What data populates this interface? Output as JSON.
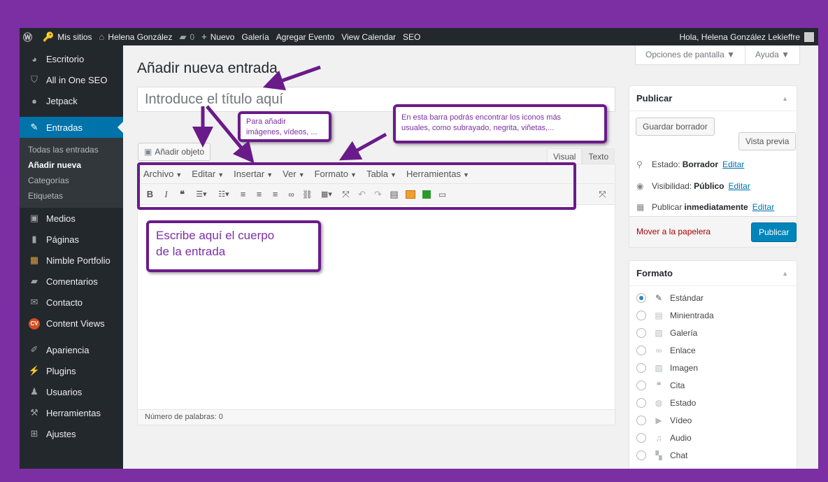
{
  "adminbar": {
    "my_sites": "Mis sitios",
    "site_name": "Helena González",
    "comments_count": "0",
    "new": "Nuevo",
    "gallery": "Galería",
    "add_event": "Agregar Evento",
    "view_calendar": "View Calendar",
    "seo": "SEO",
    "greeting": "Hola, Helena González Lekieffre"
  },
  "sidebar": {
    "items": [
      {
        "label": "Escritorio",
        "icon": "dashboard-icon"
      },
      {
        "label": "All in One SEO",
        "icon": "shield-icon"
      },
      {
        "label": "Jetpack",
        "icon": "jetpack-icon"
      },
      {
        "label": "Entradas",
        "icon": "pin-icon"
      },
      {
        "label": "Medios",
        "icon": "media-icon"
      },
      {
        "label": "Páginas",
        "icon": "pages-icon"
      },
      {
        "label": "Nimble Portfolio",
        "icon": "portfolio-icon"
      },
      {
        "label": "Comentarios",
        "icon": "comment-icon"
      },
      {
        "label": "Contacto",
        "icon": "mail-icon"
      },
      {
        "label": "Content Views",
        "icon": "cv-icon"
      },
      {
        "label": "Apariencia",
        "icon": "brush-icon"
      },
      {
        "label": "Plugins",
        "icon": "plugin-icon"
      },
      {
        "label": "Usuarios",
        "icon": "users-icon"
      },
      {
        "label": "Herramientas",
        "icon": "wrench-icon"
      },
      {
        "label": "Ajustes",
        "icon": "settings-icon"
      }
    ],
    "cv_badge": "CV",
    "submenu": [
      "Todas las entradas",
      "Añadir nueva",
      "Categorías",
      "Etiquetas"
    ]
  },
  "screen_options": {
    "options": "Opciones de pantalla ▼",
    "help": "Ayuda ▼"
  },
  "page": {
    "title": "Añadir nueva entrada",
    "title_placeholder": "Introduce el título aquí",
    "add_media": "Añadir objeto",
    "tab_visual": "Visual",
    "tab_text": "Texto",
    "word_count": "Número de palabras: 0"
  },
  "editor_menu": [
    "Archivo",
    "Editar",
    "Insertar",
    "Ver",
    "Formato",
    "Tabla",
    "Herramientas"
  ],
  "editor_toolbar": [
    {
      "glyph": "B",
      "name": "bold-icon"
    },
    {
      "glyph": "I",
      "name": "italic-icon"
    },
    {
      "glyph": "❝",
      "name": "blockquote-icon"
    },
    {
      "glyph": "☰▾",
      "name": "bullet-list-icon"
    },
    {
      "glyph": "☷▾",
      "name": "numbered-list-icon"
    },
    {
      "glyph": "≡",
      "name": "align-left-icon"
    },
    {
      "glyph": "≡",
      "name": "align-center-icon"
    },
    {
      "glyph": "≡",
      "name": "align-right-icon"
    },
    {
      "glyph": "🔗",
      "name": "link-icon"
    },
    {
      "glyph": "⛓",
      "name": "unlink-icon"
    },
    {
      "glyph": "▦▾",
      "name": "table-icon"
    },
    {
      "glyph": "⤧",
      "name": "fullscreen-icon"
    },
    {
      "glyph": "↶",
      "name": "undo-icon"
    },
    {
      "glyph": "↷",
      "name": "redo-icon"
    },
    {
      "glyph": "▤",
      "name": "keyboard-icon"
    }
  ],
  "annotations": {
    "media_note_line1": "Para añadir",
    "media_note_line2": "imágenes, vídeos, ...",
    "toolbar_note_line1": "En esta barra podrás encontrar los iconos más",
    "toolbar_note_line2": "usuales, como subrayado, negrita, viñetas,...",
    "body_note_line1": "Escribe aquí el cuerpo",
    "body_note_line2": "de la entrada"
  },
  "publish": {
    "title": "Publicar",
    "save_draft": "Guardar borrador",
    "preview": "Vista previa",
    "status_label": "Estado:",
    "status_value": "Borrador",
    "visibility_label": "Visibilidad:",
    "visibility_value": "Público",
    "publish_label": "Publicar",
    "publish_value": "inmediatamente",
    "edit": "Editar",
    "trash": "Mover a la papelera",
    "publish_button": "Publicar"
  },
  "format": {
    "title": "Formato",
    "options": [
      {
        "label": "Estándar",
        "icon": "pin-icon",
        "checked": true
      },
      {
        "label": "Minientrada",
        "icon": "aside-icon"
      },
      {
        "label": "Galería",
        "icon": "gallery-icon"
      },
      {
        "label": "Enlace",
        "icon": "link-icon"
      },
      {
        "label": "Imagen",
        "icon": "image-icon"
      },
      {
        "label": "Cita",
        "icon": "quote-icon"
      },
      {
        "label": "Estado",
        "icon": "status-icon"
      },
      {
        "label": "Vídeo",
        "icon": "video-icon"
      },
      {
        "label": "Audio",
        "icon": "audio-icon"
      },
      {
        "label": "Chat",
        "icon": "chat-icon"
      }
    ]
  },
  "colors": {
    "frame": "#7b2fa3",
    "accent": "#0073aa",
    "annotation": "#6a1b8a"
  }
}
